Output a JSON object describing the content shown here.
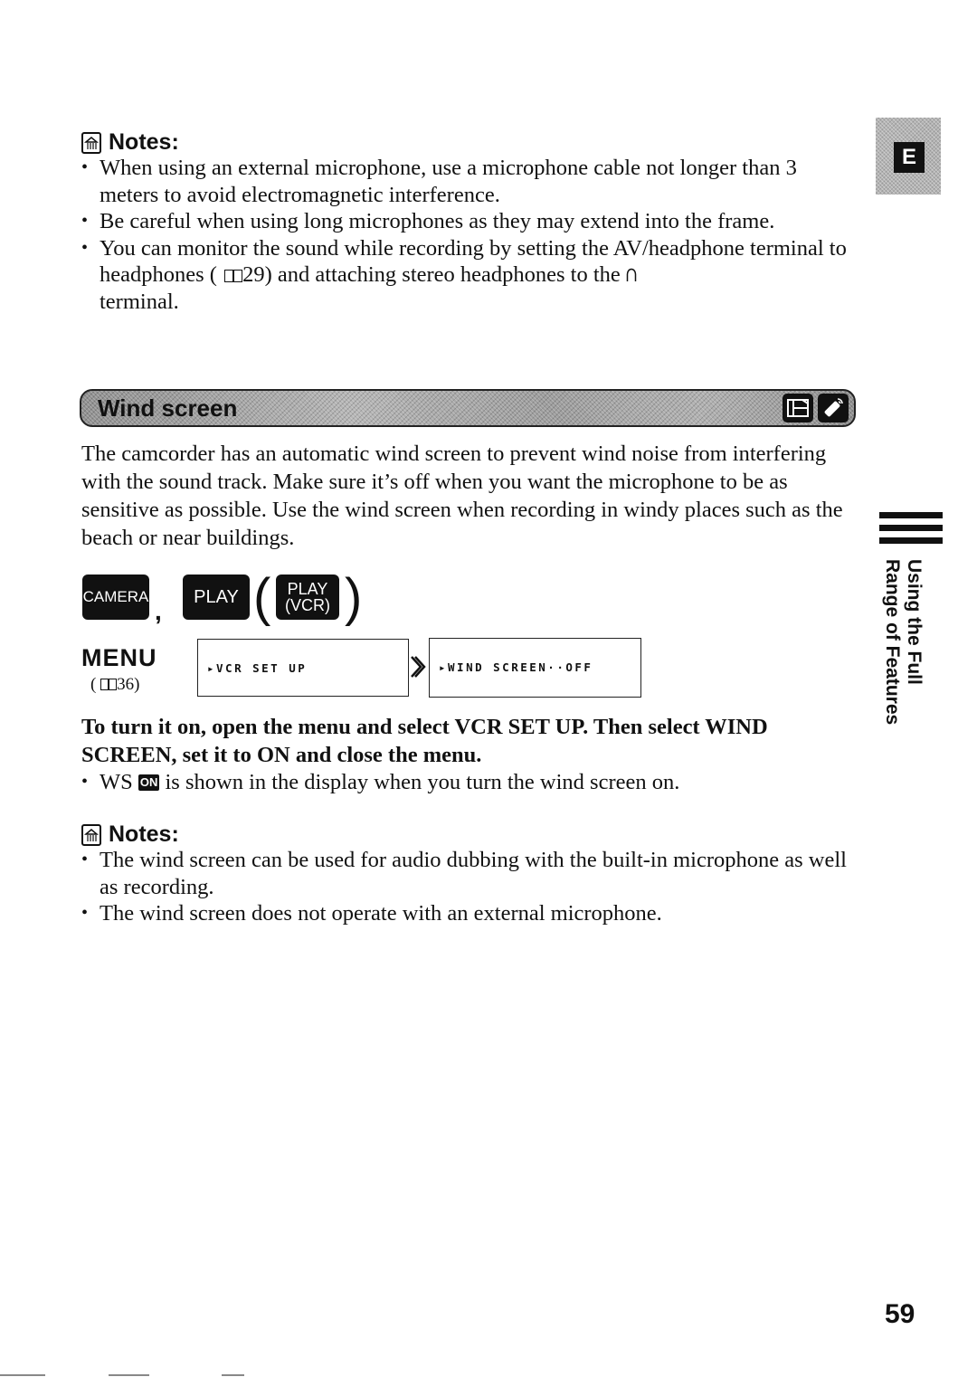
{
  "language_tab": {
    "letter": "E"
  },
  "notes_top": {
    "icon": "notes-icon",
    "title": "Notes:",
    "items": [
      "When using an external microphone, use a microphone cable not longer than 3 meters to avoid electromagnetic interference.",
      "Be careful when using long microphones as they may extend into the frame.",
      "You can monitor the sound while recording by setting the AV/headphone terminal to headphones ( 🕮29) and attaching stereo headphones to the ∩ terminal."
    ],
    "item3_parts": {
      "before_ref": "You can monitor the sound while recording by setting the AV/headphone terminal to headphones (",
      "ref_page": "29",
      "after_ref": ") and attaching stereo headphones to the",
      "end": "terminal."
    }
  },
  "section": {
    "title": "Wind screen",
    "icons": [
      "camcorder-mode-icon",
      "remote-control-icon"
    ]
  },
  "intro_paragraph": "The camcorder has an automatic wind screen to prevent wind noise from interfering with the sound track. Make sure it’s off when you want the microphone to be as sensitive as possible. Use the wind screen when recording in windy places such as the beach or near buildings.",
  "mode_keys": {
    "camera": "CAMERA",
    "separator": ",",
    "play": "PLAY",
    "play_vcr_line1": "PLAY",
    "play_vcr_line2": "(VCR)",
    "paren_open": "(",
    "paren_close": ")"
  },
  "menu": {
    "label": "MENU",
    "ref_prefix": "(",
    "ref_page": "36)",
    "screen1": "▸VCR SET UP",
    "screen2": "▸WIND SCREEN··OFF",
    "arrow": "next-step-arrow"
  },
  "instruction": "To turn it on, open the menu and select VCR SET UP. Then select WIND SCREEN, set it to ON and close the menu.",
  "display_note": {
    "prefix": "WS",
    "badge": "ON",
    "suffix": "is shown in the display when you turn the wind screen on."
  },
  "notes_bottom": {
    "title": "Notes:",
    "items": [
      "The wind screen can be used for audio dubbing with the built-in microphone as well as recording.",
      "The wind screen does not operate with an external microphone."
    ]
  },
  "side_tab": {
    "line1": "Using the Full",
    "line2": "Range of Features"
  },
  "page_number": "59"
}
